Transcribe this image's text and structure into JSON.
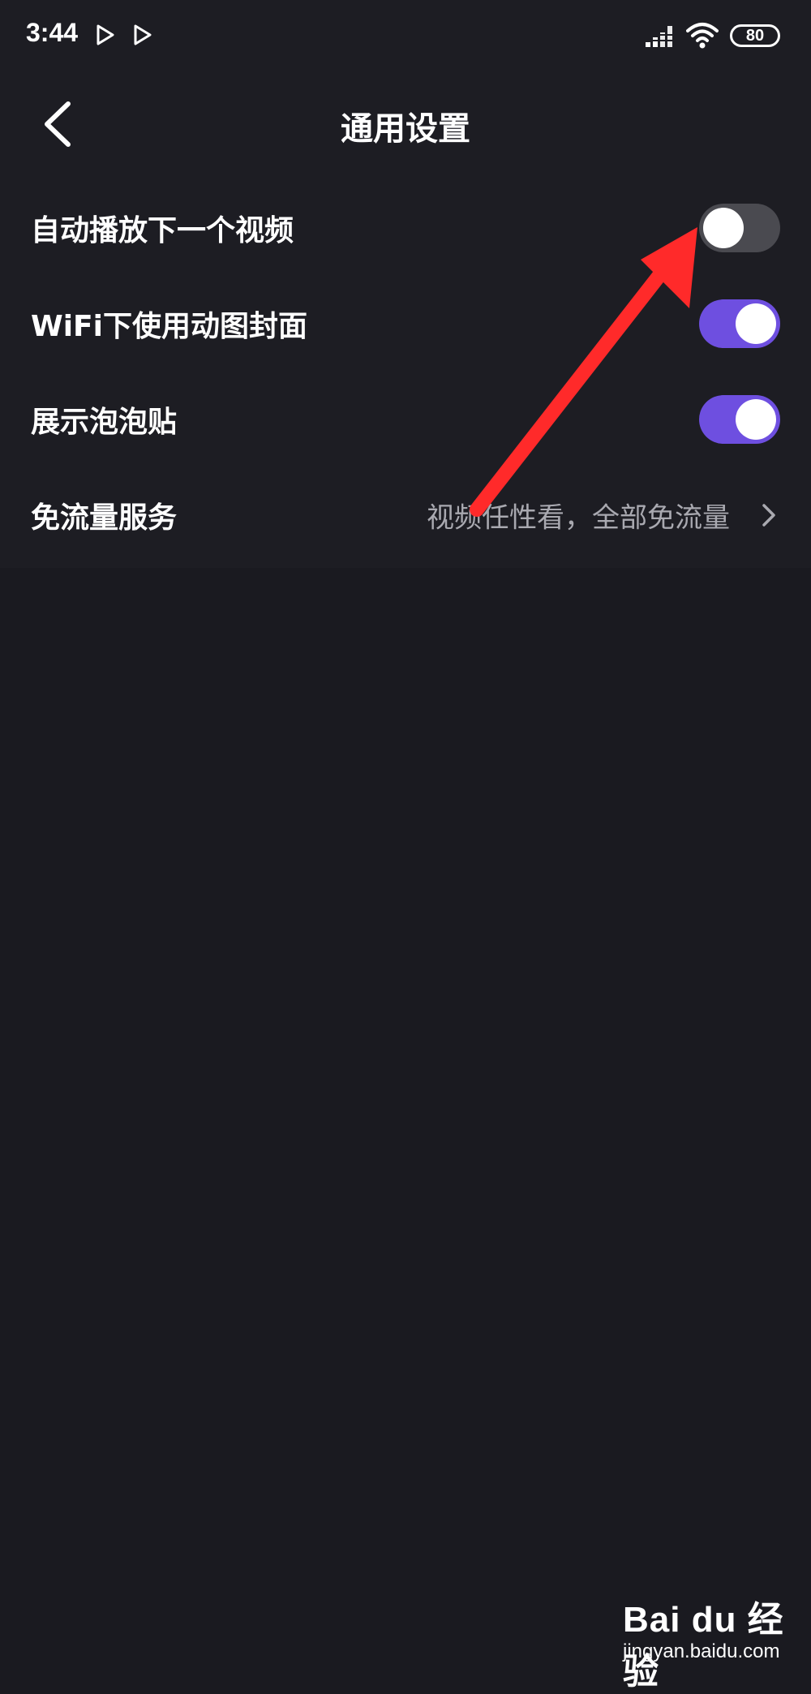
{
  "status_bar": {
    "time": "3:44",
    "battery": "80",
    "icons": [
      "play-icon",
      "play-icon",
      "signal-icon",
      "wifi-icon",
      "battery-icon"
    ]
  },
  "header": {
    "title": "通用设置",
    "back_icon": "chevron-left-icon"
  },
  "settings": [
    {
      "label": "自动播放下一个视频",
      "type": "toggle",
      "on": false
    },
    {
      "label": "WiFi下使用动图封面",
      "type": "toggle",
      "on": true
    },
    {
      "label": "展示泡泡贴",
      "type": "toggle",
      "on": true
    },
    {
      "label": "免流量服务",
      "type": "link",
      "value": "视频任性看，全部免流量",
      "icon": "chevron-right-icon"
    }
  ],
  "colors": {
    "background": "#1a1a20",
    "panel": "#1d1d23",
    "toggle_on": "#6e4fe0",
    "toggle_off": "#4a4a50",
    "arrow": "#ff2a2a"
  },
  "watermark": {
    "logo": "Bai du 经验",
    "url": "jingyan.baidu.com"
  }
}
